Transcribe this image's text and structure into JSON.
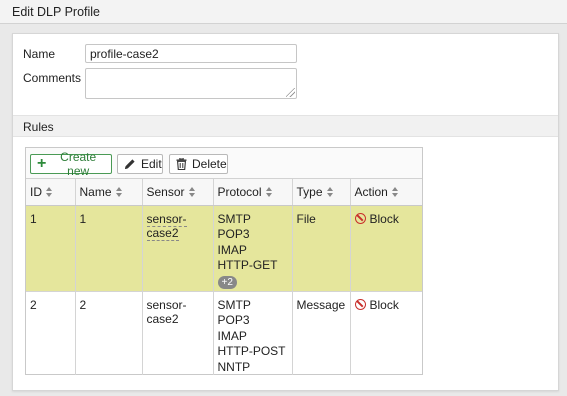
{
  "page": {
    "title": "Edit DLP Profile"
  },
  "form": {
    "name_label": "Name",
    "name_value": "profile-case2",
    "comments_label": "Comments",
    "comments_value": ""
  },
  "rules_section": {
    "title": "Rules"
  },
  "toolbar": {
    "create_label": "Create new",
    "edit_label": "Edit",
    "delete_label": "Delete"
  },
  "table": {
    "columns": [
      "ID",
      "Name",
      "Sensor",
      "Protocol",
      "Type",
      "Action"
    ],
    "rows": [
      {
        "id": "1",
        "name": "1",
        "sensor": "sensor-case2",
        "protocols": [
          "SMTP",
          "POP3",
          "IMAP",
          "HTTP-GET"
        ],
        "more": "+2",
        "type": "File",
        "action": "Block"
      },
      {
        "id": "2",
        "name": "2",
        "sensor": "sensor-case2",
        "protocols": [
          "SMTP",
          "POP3",
          "IMAP",
          "HTTP-POST",
          "NNTP"
        ],
        "type": "Message",
        "action": "Block"
      }
    ]
  },
  "colors": {
    "selected_row": "#e5e69c",
    "create_accent": "#2d8a3a",
    "block_red": "#c9302c"
  },
  "icons": {
    "create": "plus-icon",
    "edit": "pencil-icon",
    "delete": "trash-icon",
    "action": "block-icon",
    "sort": "sort-icon"
  }
}
